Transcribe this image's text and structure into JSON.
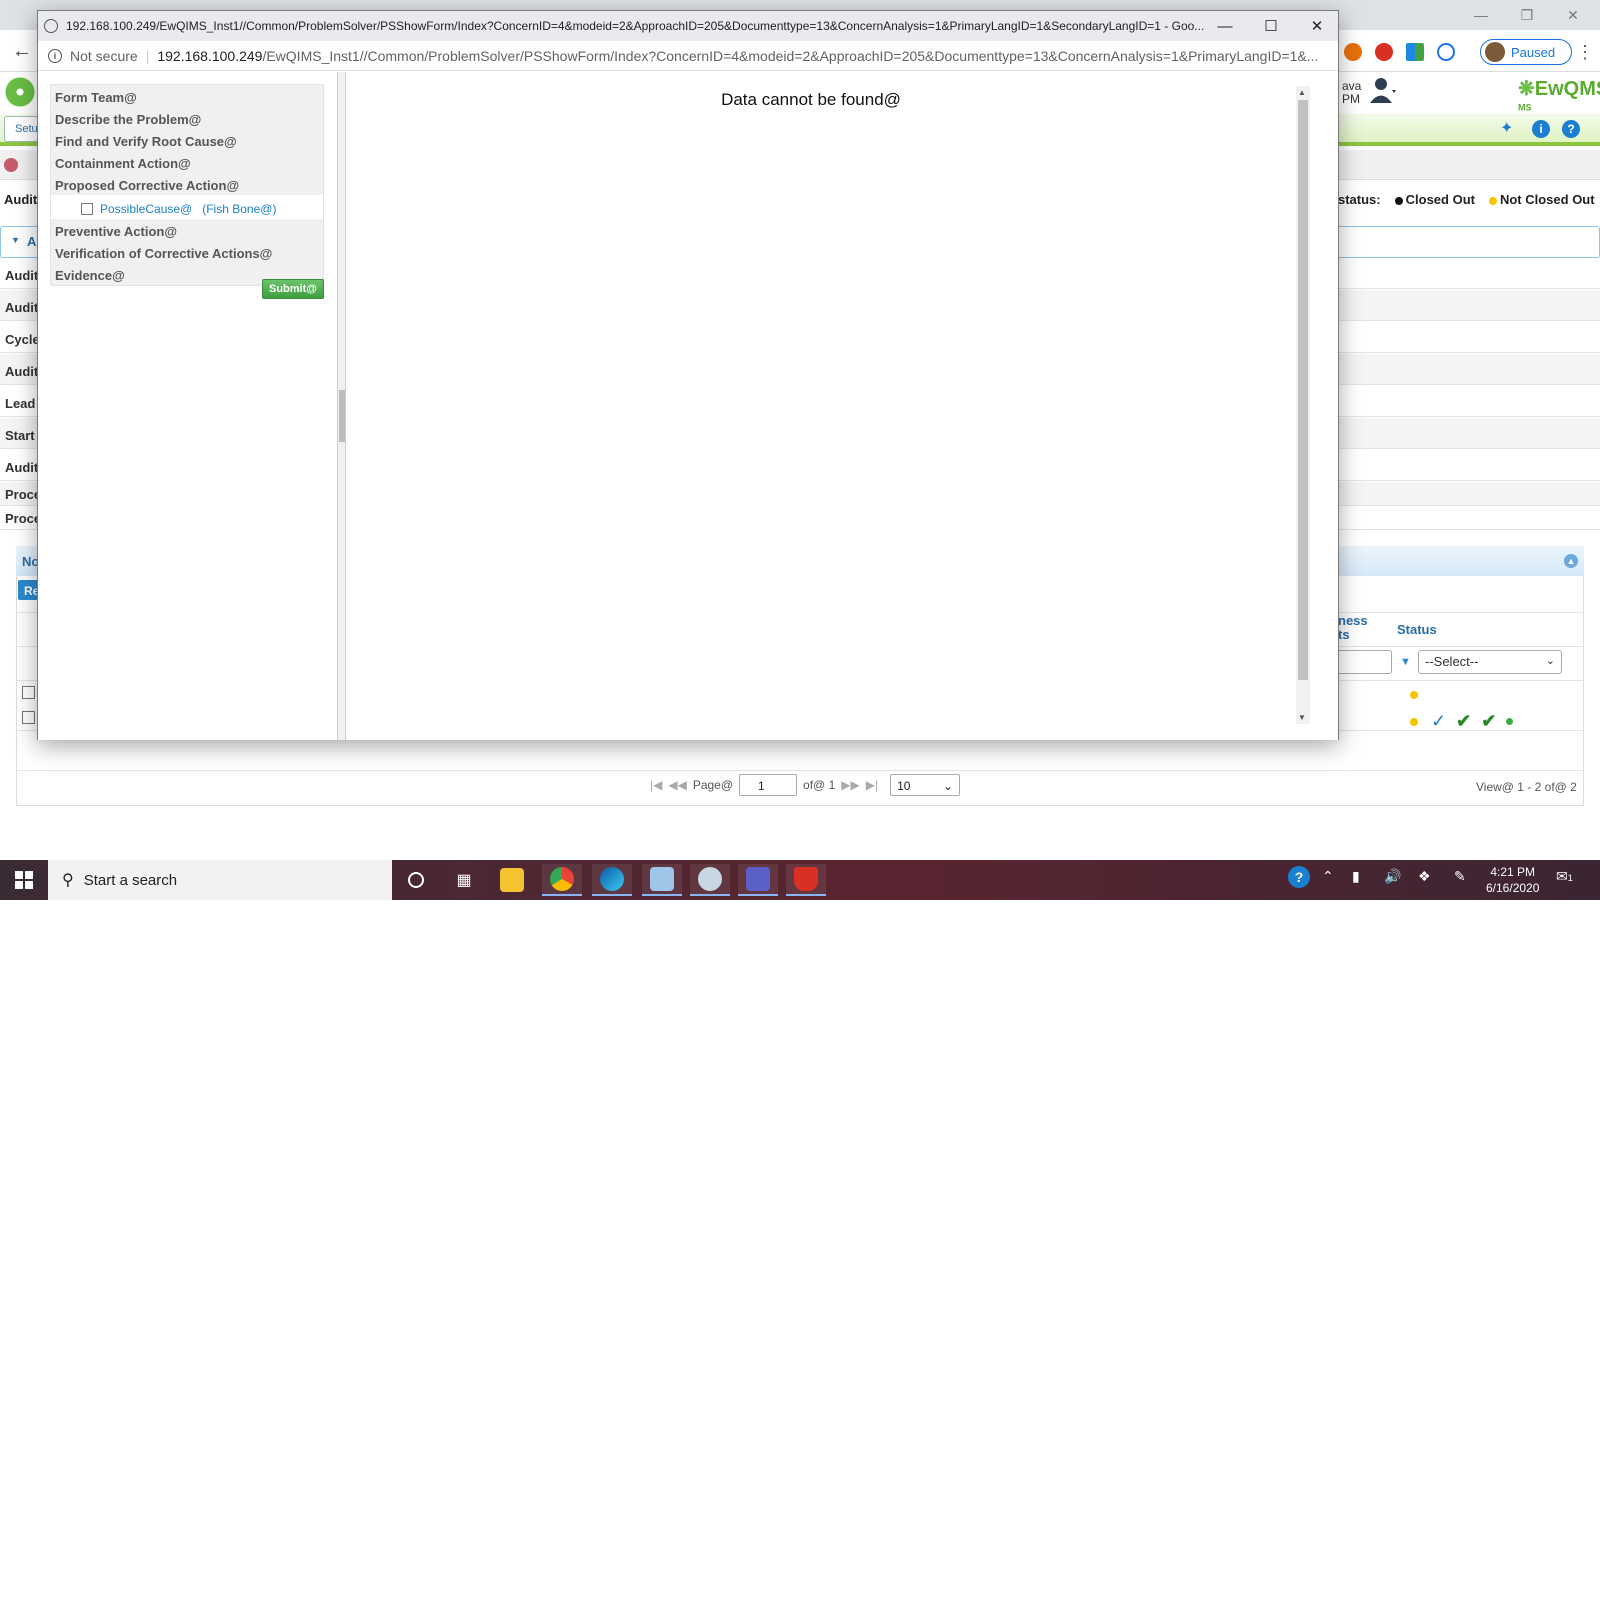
{
  "popup": {
    "title": "192.168.100.249/EwQIMS_Inst1//Common/ProblemSolver/PSShowForm/Index?ConcernID=4&modeid=2&ApproachID=205&Documenttype=13&ConcernAnalysis=1&PrimaryLangID=1&SecondaryLangID=1 - Goo...",
    "not_secure": "Not secure",
    "address_host": "192.168.100.249",
    "address_path": "/EwQIMS_Inst1//Common/ProblemSolver/PSShowForm/Index?ConcernID=4&modeid=2&ApproachID=205&Documenttype=13&ConcernAnalysis=1&PrimaryLangID=1&...",
    "menu": {
      "form_team": "Form Team@",
      "describe_problem": "Describe the Problem@",
      "find_root_cause": "Find and Verify Root Cause@",
      "containment_action": "Containment Action@",
      "proposed_corrective": "Proposed Corrective Action@",
      "possible_cause": "PossibleCause@",
      "fish_bone": "(Fish Bone@)",
      "preventive_action": "Preventive Action@",
      "verification": "Verification of Corrective Actions@",
      "evidence": "Evidence@"
    },
    "submit_label": "Submit@",
    "no_data_message": "Data cannot be found@"
  },
  "background": {
    "profile_chip": "Paused",
    "user_fragment_1": "ava",
    "user_fragment_2": "PM",
    "brand_logo": "EwQMS",
    "brand_sup": "I MS",
    "setup_tab": "Setu",
    "status_label": "status:",
    "legend_closed": "Closed Out",
    "legend_not_closed": "Not Closed Out",
    "row_labels": [
      "Audit",
      "Audit",
      "Cycle",
      "Audit",
      "Lead",
      "Start",
      "Audit",
      "Proce",
      "Proce"
    ],
    "top_label": "Audit",
    "collapse_label": "A",
    "nc_head": "No",
    "nc_btn": "Re",
    "col_ness_1": "ness",
    "col_ness_2": "ts",
    "col_status": "Status",
    "status_select": "--Select--",
    "pager": {
      "page_label": "Page@",
      "page_value": "1",
      "of_label": "of@ 1",
      "per_page": "10"
    },
    "view_count": "View@ 1 - 2 of@ 2"
  },
  "taskbar": {
    "search_placeholder": "Start a search",
    "time": "4:21 PM",
    "date": "6/16/2020",
    "notif_count": "1"
  },
  "colors": {
    "accent_green": "#8cc63f",
    "link_blue": "#1a7fc4",
    "closed_dot": "#111111",
    "not_closed_dot": "#f5c400"
  }
}
